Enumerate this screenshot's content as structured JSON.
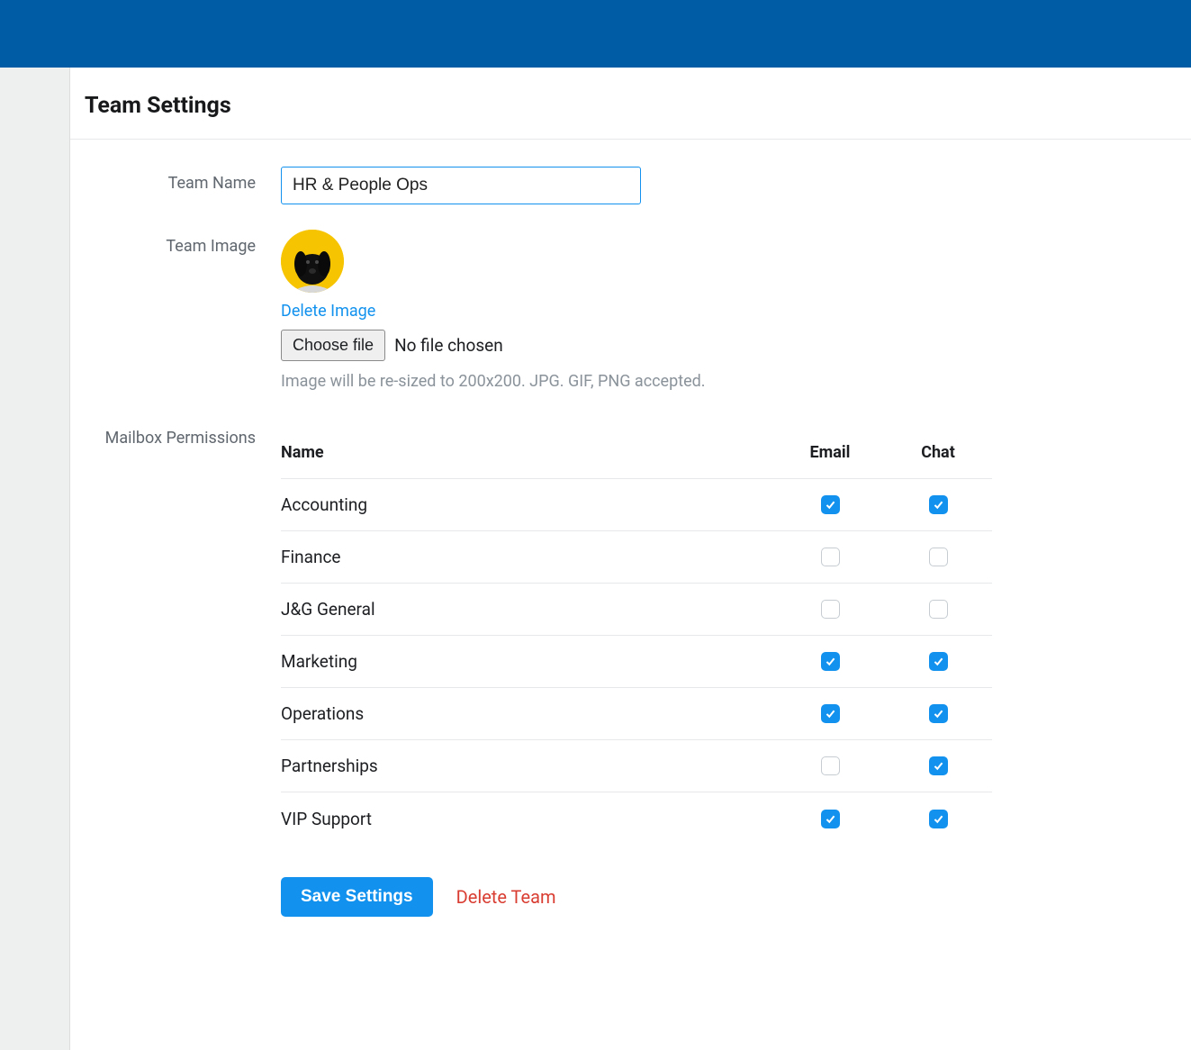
{
  "page": {
    "title": "Team Settings"
  },
  "form": {
    "team_name": {
      "label": "Team Name",
      "value": "HR & People Ops"
    },
    "team_image": {
      "label": "Team Image",
      "delete_link": "Delete Image",
      "choose_file_label": "Choose file",
      "file_status": "No file chosen",
      "hint": "Image will be re-sized to 200x200. JPG. GIF, PNG accepted."
    },
    "permissions": {
      "label": "Mailbox Permissions",
      "header": {
        "name": "Name",
        "email": "Email",
        "chat": "Chat"
      },
      "rows": [
        {
          "name": "Accounting",
          "email": true,
          "chat": true
        },
        {
          "name": "Finance",
          "email": false,
          "chat": false
        },
        {
          "name": "J&G General",
          "email": false,
          "chat": false
        },
        {
          "name": "Marketing",
          "email": true,
          "chat": true
        },
        {
          "name": "Operations",
          "email": true,
          "chat": true
        },
        {
          "name": "Partnerships",
          "email": false,
          "chat": true
        },
        {
          "name": "VIP Support",
          "email": true,
          "chat": true
        }
      ]
    }
  },
  "actions": {
    "save": "Save Settings",
    "delete_team": "Delete Team"
  },
  "colors": {
    "header_bg": "#005ca4",
    "accent": "#1292ee",
    "danger": "#d93d32",
    "avatar_bg": "#f6c400"
  }
}
